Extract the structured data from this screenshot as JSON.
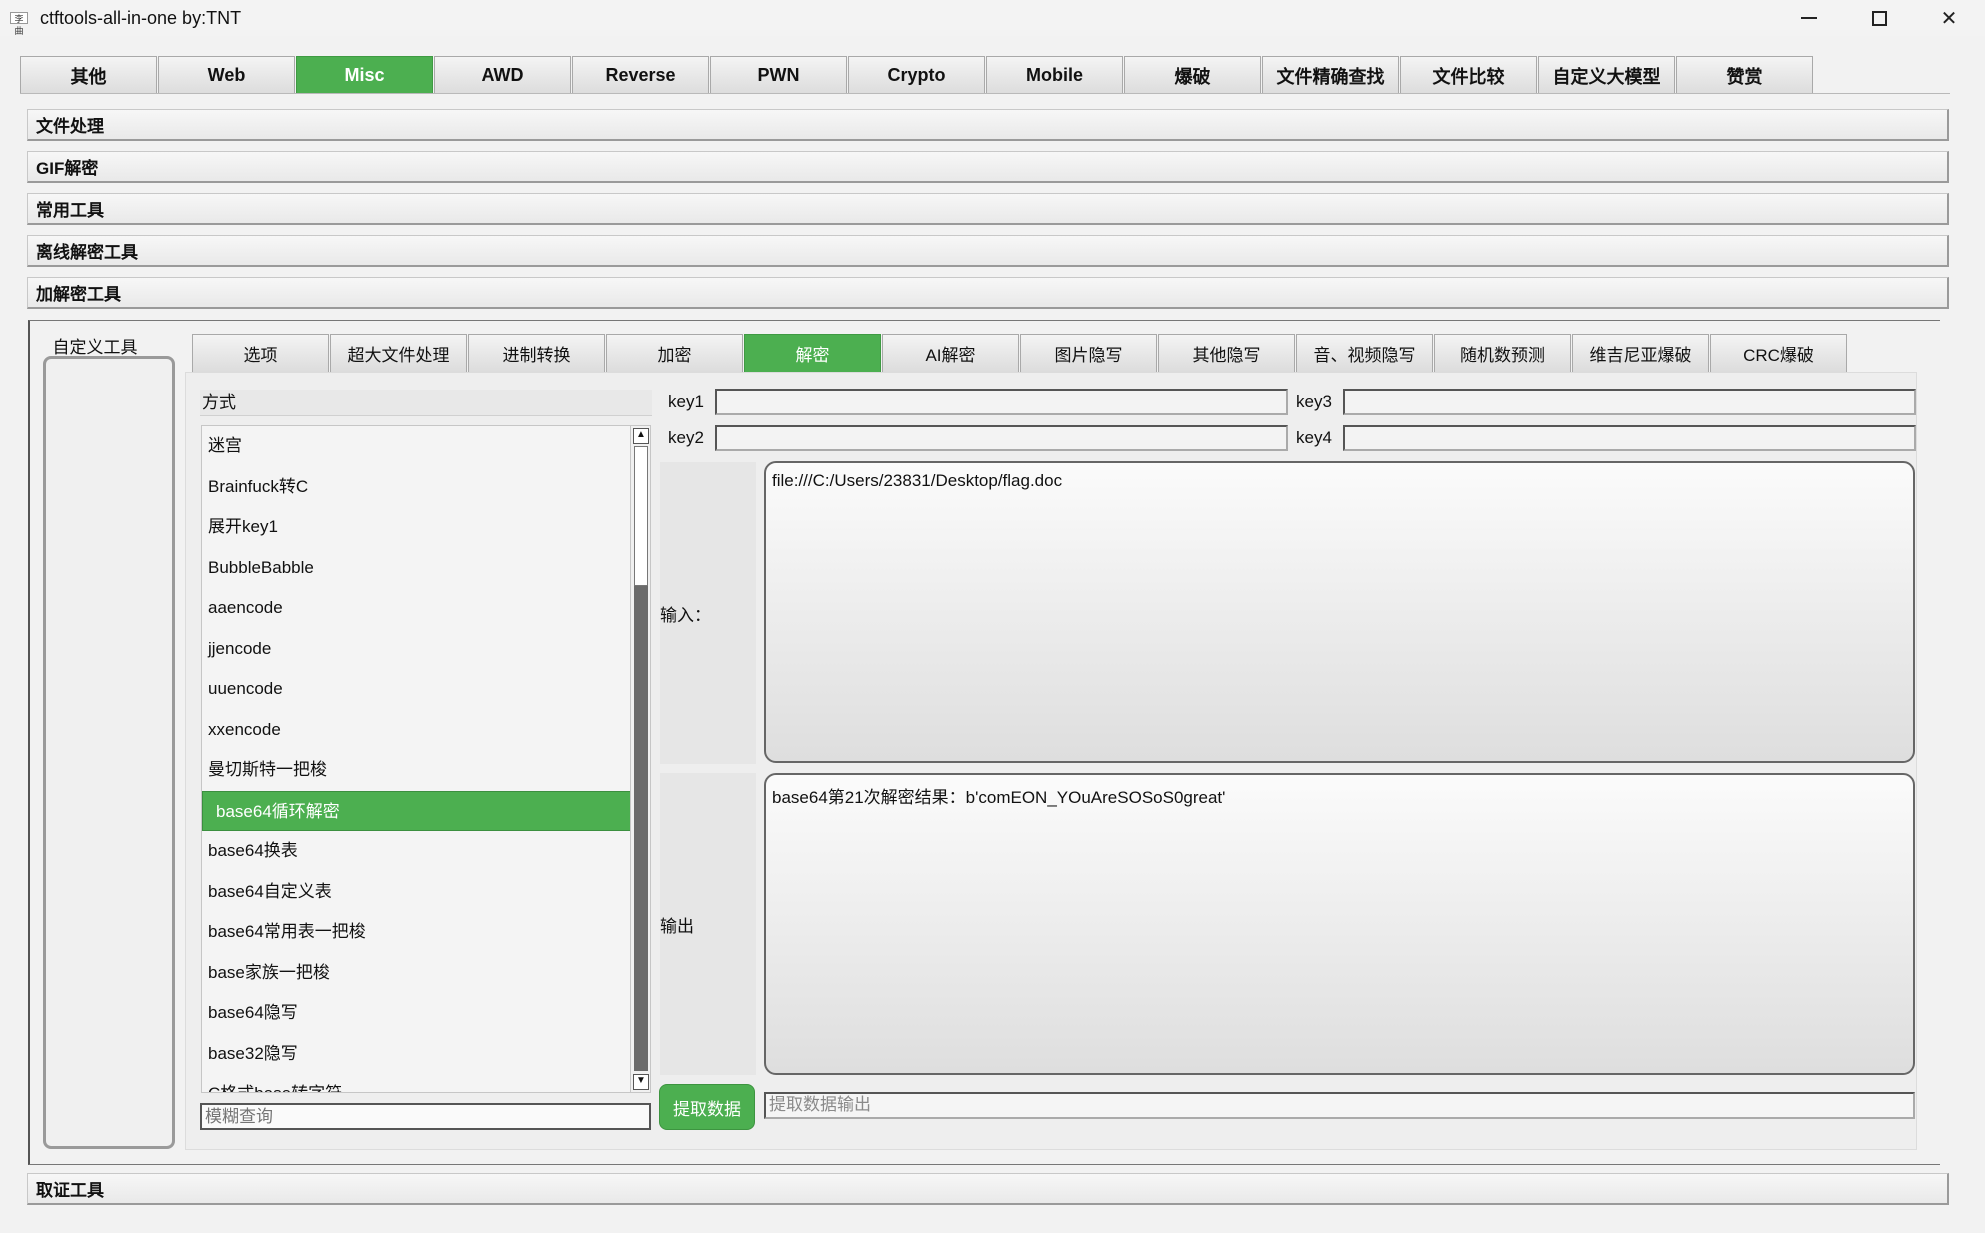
{
  "window": {
    "icon_text": "李曲",
    "title": "ctftools-all-in-one   by:TNT"
  },
  "top_tabs": [
    "其他",
    "Web",
    "Misc",
    "AWD",
    "Reverse",
    "PWN",
    "Crypto",
    "Mobile",
    "爆破",
    "文件精确查找",
    "文件比较",
    "自定义大模型",
    "赞赏"
  ],
  "top_tab_active": "Misc",
  "sections": [
    "文件处理",
    "GIF解密",
    "常用工具",
    "离线解密工具",
    "加解密工具"
  ],
  "bottom_section": "取证工具",
  "custom_tools_label": "自定义工具",
  "sub_tabs": [
    "选项",
    "超大文件处理",
    "进制转换",
    "加密",
    "解密",
    "AI解密",
    "图片隐写",
    "其他隐写",
    "音、视频隐写",
    "随机数预测",
    "维吉尼亚爆破",
    "CRC爆破"
  ],
  "sub_tab_active": "解密",
  "method": {
    "header": "方式",
    "items": [
      "迷宫",
      "Brainfuck转C",
      "展开key1",
      "BubbleBabble",
      "aaencode",
      "jjencode",
      "uuencode",
      "xxencode",
      "曼切斯特一把梭",
      "base64循环解密",
      "base64换表",
      "base64自定义表",
      "base64常用表一把梭",
      "base家族一把梭",
      "base64隐写",
      "base32隐写",
      "C格式base转字符"
    ],
    "selected": "base64循环解密",
    "fuzzy_placeholder": "模糊查询"
  },
  "keys": {
    "key1_label": "key1",
    "key1_value": "",
    "key2_label": "key2",
    "key2_value": "",
    "key3_label": "key3",
    "key3_value": "",
    "key4_label": "key4",
    "key4_value": ""
  },
  "input": {
    "label": "输入：",
    "value": "file:///C:/Users/23831/Desktop/flag.doc"
  },
  "output": {
    "label": "输出",
    "value": "base64第21次解密结果：b'comEON_YOuAreSOSoS0great'"
  },
  "extract": {
    "button_label": "提取数据",
    "output_placeholder": "提取数据输出"
  },
  "colors": {
    "accent_green": "#4caf50"
  }
}
